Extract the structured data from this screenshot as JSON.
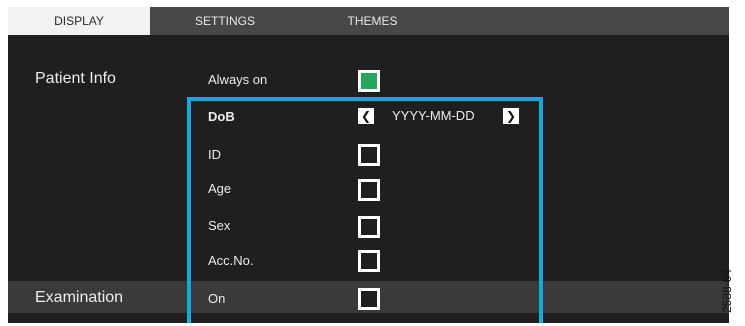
{
  "tabs": [
    {
      "label": "DISPLAY",
      "active": true
    },
    {
      "label": "SETTINGS",
      "active": false
    },
    {
      "label": "THEMES",
      "active": false
    }
  ],
  "patient_info": {
    "section_label": "Patient Info",
    "always_on": {
      "label": "Always on",
      "checked": true
    },
    "dob": {
      "label": "DoB",
      "format": "YYYY-MM-DD",
      "prev_icon": "chevron-left-icon",
      "next_icon": "chevron-right-icon"
    },
    "id": {
      "label": "ID",
      "checked": false
    },
    "age": {
      "label": "Age",
      "checked": false
    },
    "sex": {
      "label": "Sex",
      "checked": false
    },
    "acc_no": {
      "label": "Acc.No.",
      "checked": false
    }
  },
  "examination": {
    "section_label": "Examination",
    "on": {
      "label": "On",
      "checked": false
    }
  },
  "figure_ref": "2588-04",
  "colors": {
    "highlight": "#1aa7e0",
    "checked": "#26a65b",
    "background": "#1f1f1f"
  }
}
